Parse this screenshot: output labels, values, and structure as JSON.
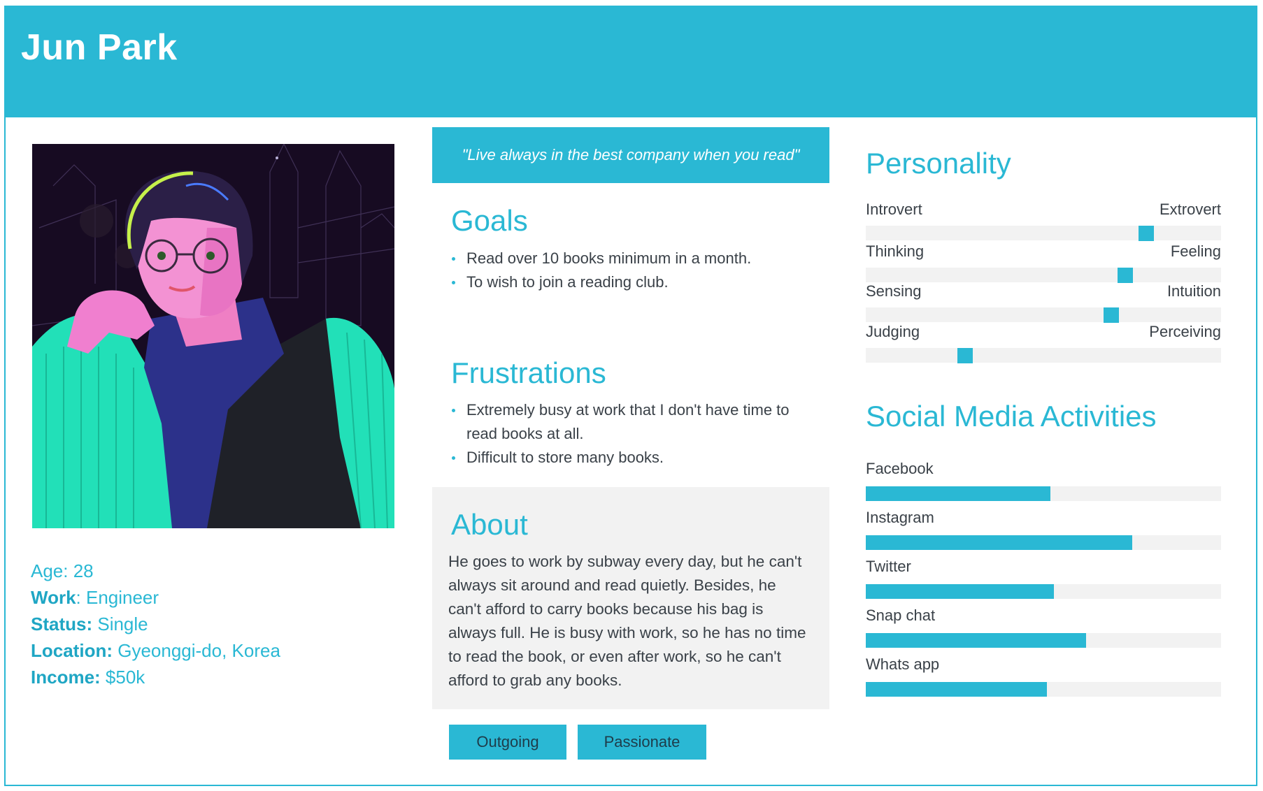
{
  "persona": {
    "name": "Jun Park",
    "quote": "\"Live always in the best company when you read\"",
    "info": [
      {
        "label": "Age:",
        "value": " 28",
        "bold": false
      },
      {
        "label": "Work",
        "value": ": Engineer",
        "bold": true
      },
      {
        "label": "Status:",
        "value": " Single",
        "bold": true
      },
      {
        "label": "Location:",
        "value": " Gyeonggi-do, Korea",
        "bold": true
      },
      {
        "label": "Income:",
        "value": " $50k",
        "bold": true
      }
    ]
  },
  "goals": {
    "title": "Goals",
    "items": [
      "Read over 10 books minimum in a month.",
      "To wish to join a reading club."
    ]
  },
  "frustrations": {
    "title": "Frustrations",
    "items": [
      "Extremely busy at work that I don't have time to read books at all.",
      "Difficult to store many books."
    ]
  },
  "about": {
    "title": "About",
    "text": "He goes to work by subway every day, but he can't always sit around and read quietly. Besides, he can't afford to carry books because his bag is always full. He is busy with work, so he has no time to read the book, or even after work, so he can't afford to grab any books."
  },
  "tags": [
    "Outgoing",
    "Passionate"
  ],
  "personality": {
    "title": "Personality",
    "traits": [
      {
        "left": "Introvert",
        "right": "Extrovert",
        "position": 0.79
      },
      {
        "left": "Thinking",
        "right": "Feeling",
        "position": 0.73
      },
      {
        "left": "Sensing",
        "right": "Intuition",
        "position": 0.69
      },
      {
        "left": "Judging",
        "right": "Perceiving",
        "position": 0.28
      }
    ]
  },
  "social": {
    "title": "Social Media Activities",
    "items": [
      {
        "name": "Facebook",
        "level": 0.52
      },
      {
        "name": "Instagram",
        "level": 0.75
      },
      {
        "name": "Twitter",
        "level": 0.53
      },
      {
        "name": "Snap chat",
        "level": 0.62
      },
      {
        "name": "Whats app",
        "level": 0.51
      }
    ]
  },
  "colors": {
    "accent": "#2ab8d4",
    "track": "#f2f2f2",
    "text": "#3a4148"
  }
}
